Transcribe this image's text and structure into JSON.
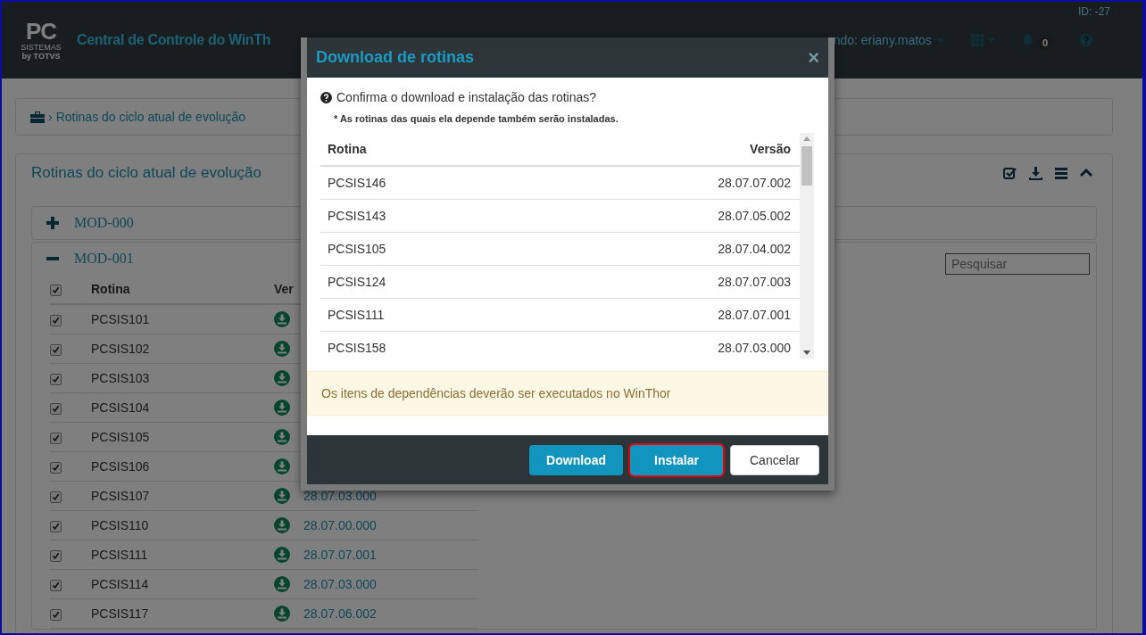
{
  "header": {
    "logo": {
      "mark": "PC",
      "sub": "SISTEMAS",
      "by": "by TOTVS"
    },
    "title": "Central de Controle do WinTh",
    "user": "ndo: eriany.matos",
    "id": "ID: -27",
    "notifications": "0"
  },
  "breadcrumb": {
    "separator": "›",
    "label": "Rotinas do ciclo atual de evolução"
  },
  "panel": {
    "title": "Rotinas do ciclo atual de evolução",
    "modules": [
      {
        "name": "MOD-000",
        "expanded": false
      },
      {
        "name": "MOD-001",
        "expanded": true
      }
    ],
    "search": {
      "placeholder": "Pesquisar"
    },
    "table": {
      "all_checked": true,
      "columns": [
        "Rotina",
        "Ver"
      ],
      "rows": [
        {
          "checked": true,
          "rotina": "PCSIS101"
        },
        {
          "checked": true,
          "rotina": "PCSIS102"
        },
        {
          "checked": true,
          "rotina": "PCSIS103"
        },
        {
          "checked": true,
          "rotina": "PCSIS104"
        },
        {
          "checked": true,
          "rotina": "PCSIS105"
        },
        {
          "checked": true,
          "rotina": "PCSIS106"
        },
        {
          "checked": true,
          "rotina": "PCSIS107",
          "version": "28.07.03.000"
        },
        {
          "checked": true,
          "rotina": "PCSIS110",
          "version": "28.07.00.000"
        },
        {
          "checked": true,
          "rotina": "PCSIS111",
          "version": "28.07.07.001"
        },
        {
          "checked": true,
          "rotina": "PCSIS114",
          "version": "28.07.03.000"
        },
        {
          "checked": true,
          "rotina": "PCSIS117",
          "version": "28.07.06.002"
        }
      ]
    }
  },
  "dialog": {
    "title": "Download de rotinas",
    "close": "×",
    "question": "Confirma o download e instalação das rotinas?",
    "note": "* As rotinas das quais ela depende também serão instaladas.",
    "columns": [
      "Rotina",
      "Versão"
    ],
    "rows": [
      {
        "rotina": "PCSIS146",
        "versao": "28.07.07.002"
      },
      {
        "rotina": "PCSIS143",
        "versao": "28.07.05.002"
      },
      {
        "rotina": "PCSIS105",
        "versao": "28.07.04.002"
      },
      {
        "rotina": "PCSIS124",
        "versao": "28.07.07.003"
      },
      {
        "rotina": "PCSIS111",
        "versao": "28.07.07.001"
      },
      {
        "rotina": "PCSIS158",
        "versao": "28.07.03.000"
      }
    ],
    "alert": "Os itens de dependências deverão ser executados no WinThor",
    "buttons": [
      {
        "label": "Download",
        "kind": "primary",
        "highlighted": false
      },
      {
        "label": "Instalar",
        "kind": "primary",
        "highlighted": true
      },
      {
        "label": "Cancelar",
        "kind": "default",
        "highlighted": false
      }
    ]
  }
}
